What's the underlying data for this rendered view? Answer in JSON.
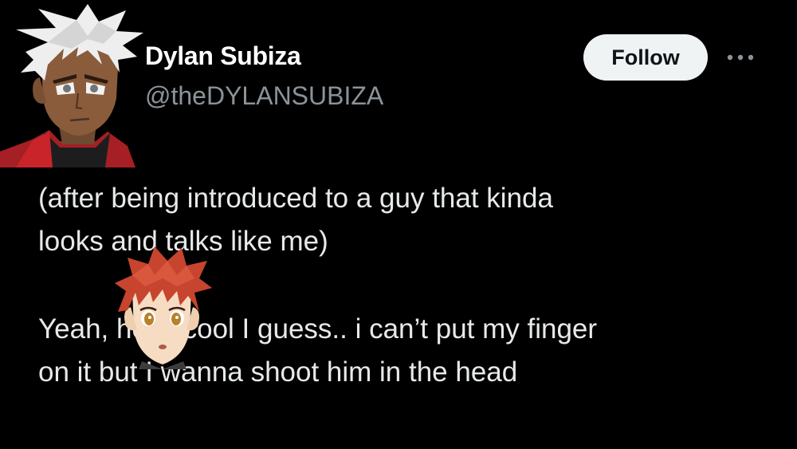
{
  "author": {
    "display_name": "Dylan Subiza",
    "handle": "@theDYLANSUBIZA",
    "avatar_icon": "anime-character-white-hair-avatar"
  },
  "actions": {
    "follow_label": "Follow",
    "more_icon": "more-dots-icon"
  },
  "tweet": {
    "paragraph1": [
      "(after being introduced to a guy that  kinda",
      "looks and talks like me)"
    ],
    "paragraph2": [
      "Yeah, he is cool I guess.. i can’t put my finger",
      "on it but I wanna shoot him in the head"
    ],
    "inline_image_icon": "anime-character-red-hair-face"
  },
  "colors": {
    "background": "#000000",
    "text": "#e7e9ea",
    "secondary": "#8b9399",
    "follow_bg": "#eff3f4",
    "follow_text": "#0f1419"
  }
}
